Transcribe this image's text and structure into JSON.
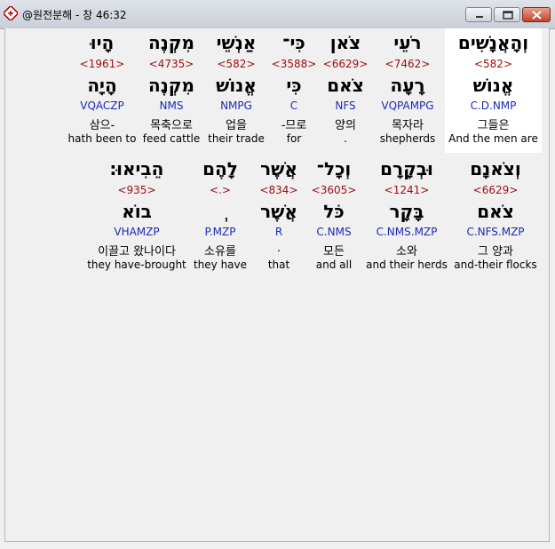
{
  "window": {
    "title": "@원전분해 - 창 46:32",
    "icon": "app-book-icon"
  },
  "colors": {
    "strong": "#9b0d0d",
    "parse": "#1c2bb0",
    "highlight": "#ffffff"
  },
  "rows": [
    {
      "words": [
        {
          "hebrew": "וְהָאֲנָשִׁים",
          "strong": "<582>",
          "root": "אֱנוֹשׁ",
          "parse": "C.D.NMP",
          "korean": "그들은",
          "english": "And the men are"
        },
        {
          "hebrew": "רֹעֵי",
          "strong": "<7462>",
          "root": "רָעָה",
          "parse": "VQPAMPG",
          "korean": "목자라",
          "english": "shepherds"
        },
        {
          "hebrew": "צֹאן",
          "strong": "<6629>",
          "root": "צֹאם",
          "parse": "NFS",
          "korean": "양의",
          "english": "."
        },
        {
          "hebrew": "כִּי־",
          "strong": "<3588>",
          "root": "כִּי",
          "parse": "C",
          "korean": "-므로",
          "english": "for"
        },
        {
          "hebrew": "אַנְשֵׁי",
          "strong": "<582>",
          "root": "אֱנוֹשׁ",
          "parse": "NMPG",
          "korean": "업을",
          "english": "their trade"
        },
        {
          "hebrew": "מִקְנֶה",
          "strong": "<4735>",
          "root": "מִקְנֶה",
          "parse": "NMS",
          "korean": "목축으로",
          "english": "feed cattle"
        },
        {
          "hebrew": "הָיוּ",
          "strong": "<1961>",
          "root": "הָיָה",
          "parse": "VQACZP",
          "korean": "삼으-",
          "english": "hath been to"
        }
      ]
    },
    {
      "words": [
        {
          "hebrew": "וְצֹאנָם",
          "strong": "<6629>",
          "root": "צֹאם",
          "parse": "C.NFS.MZP",
          "korean": "그 양과",
          "english": "and-their flocks"
        },
        {
          "hebrew": "וּבְקָרָם",
          "strong": "<1241>",
          "root": "בָּקָר",
          "parse": "C.NMS.MZP",
          "korean": "소와",
          "english": "and their herds"
        },
        {
          "hebrew": "וְכָל־",
          "strong": "<3605>",
          "root": "כֹּל",
          "parse": "C.NMS",
          "korean": "모든",
          "english": "and all"
        },
        {
          "hebrew": "אֲשֶׁר",
          "strong": "<834>",
          "root": "אֲשֶׁר",
          "parse": "R",
          "korean": ".",
          "english": "that"
        },
        {
          "hebrew": "לָהֶם",
          "strong": "<.>",
          "root": "ְ",
          "parse": "P.MZP",
          "korean": "소유를",
          "english": "they have"
        },
        {
          "hebrew": "הֵבִיאוּ׃",
          "strong": "<935>",
          "root": "בוֹא",
          "parse": "VHAMZP",
          "korean": "이끌고 왔나이다",
          "english": "they have-brought"
        }
      ]
    }
  ]
}
